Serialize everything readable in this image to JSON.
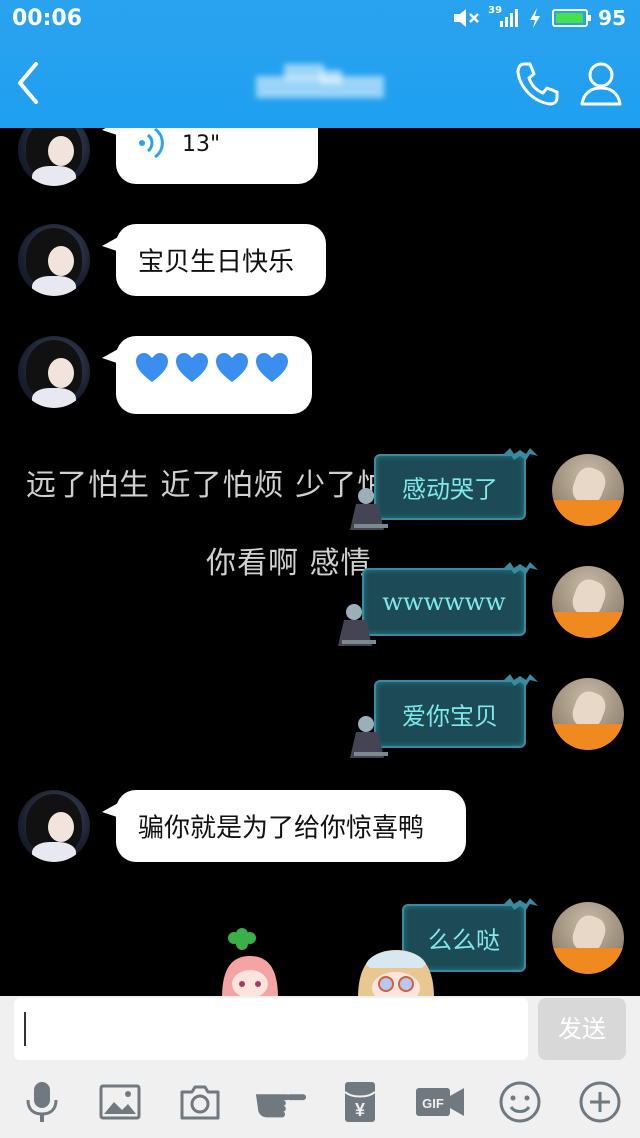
{
  "status": {
    "time": "00:06",
    "network": "39",
    "battery": "95",
    "battery_level": 0.95
  },
  "header": {
    "back_icon": "back-icon",
    "call_icon": "phone-icon",
    "profile_icon": "person-icon"
  },
  "chat": {
    "background_lines": [
      "远了怕生 近了怕烦 少了怕",
      "你看啊 感情"
    ],
    "voice_message": {
      "duration": "13\""
    },
    "messages_left": [
      "宝贝生日快乐",
      "骗你就是为了给你惊喜鸭"
    ],
    "hearts_count": 4,
    "messages_right": [
      "感动哭了",
      "wwwwww",
      "爱你宝贝",
      "么么哒"
    ]
  },
  "composer": {
    "input_value": "",
    "send_label": "发送"
  },
  "toolbar": {
    "items": [
      "microphone-icon",
      "image-icon",
      "camera-icon",
      "hand-poke-icon",
      "red-packet-icon",
      "gif-icon",
      "emoji-icon",
      "plus-icon"
    ],
    "gif_label": "GIF",
    "yen_label": "¥"
  },
  "colors": {
    "header": "#1f9ff0",
    "bubble_left": "#ffffff",
    "bubble_right": "#1c4b55",
    "bubble_right_text": "#7fe8ea"
  }
}
